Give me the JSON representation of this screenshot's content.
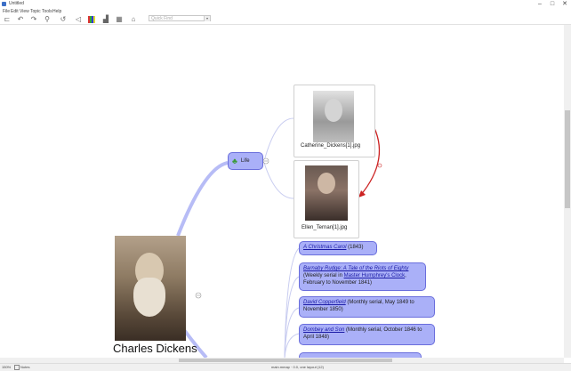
{
  "window": {
    "title": "Untitled",
    "buttons": {
      "minimize": "–",
      "maximize": "□",
      "close": "✕"
    }
  },
  "menu": [
    "File",
    "Edit",
    "View",
    "Topic",
    "Tools",
    "Help"
  ],
  "toolbar": {
    "quick_find_placeholder": "Quick Find",
    "icons": [
      "new-map-icon",
      "undo-icon",
      "redo-icon",
      "link-icon",
      "arrow-icon",
      "insert-topic-icon",
      "boundary-icon",
      "color-icon",
      "chart-icon",
      "table-icon",
      "tree-icon"
    ]
  },
  "map": {
    "central": {
      "label": "Charles Dickens"
    },
    "life": {
      "label": "Life",
      "icon": "tree-icon"
    },
    "images": [
      {
        "caption": "Catherine_Dickens[1].jpg"
      },
      {
        "caption": "Ellen_Ternan[1].jpg"
      }
    ],
    "works": [
      {
        "title": "A Christmas Carol",
        "detail": " (1843)"
      },
      {
        "title": "Barnaby Rudge: A Tale of the Riots of Eighty",
        "detail": " (Weekly serial in ",
        "link2": "Master Humphrey's Clock",
        "detail2": ", February to November 1841)"
      },
      {
        "title": "David Copperfield",
        "detail": " (Monthly serial, May 1849 to November 1850)"
      },
      {
        "title": "Dombey and Son",
        "detail": " (Monthly serial, October 1846 to April 1848)"
      }
    ],
    "colors": {
      "node_fill": "#aab0f8",
      "node_border": "#6a6edc",
      "branch": "#b7bcf6",
      "relation_arrow": "#cc2222"
    }
  },
  "status": {
    "zoom": "150%",
    "layer": "Notes",
    "info": "main.mmap · 0.0, one layout (12)"
  }
}
